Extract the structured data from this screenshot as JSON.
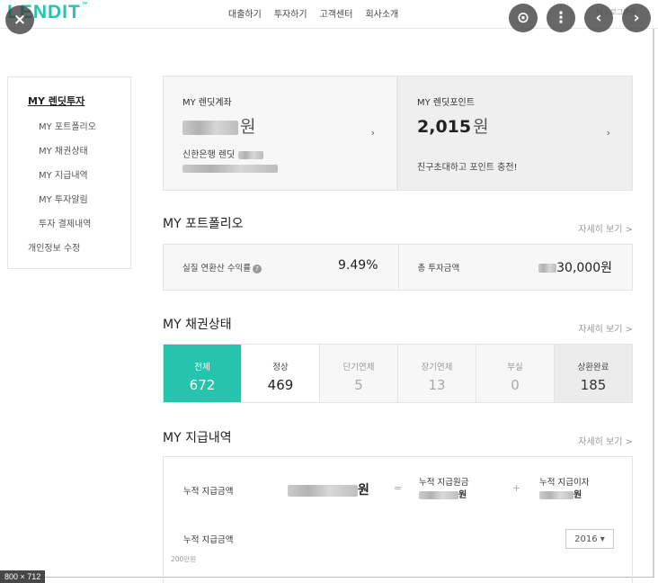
{
  "header": {
    "logo": "LENDIT",
    "logo_tm": "™",
    "nav": [
      "대출하기",
      "투자하기",
      "고객센터",
      "회사소개"
    ],
    "right_text": "님 | 로그아웃"
  },
  "viewer": {
    "size_badge": "800 × 712",
    "close_icon": "×",
    "lens_icon": "⊙",
    "more_icon": "⋮",
    "prev_icon": "‹",
    "next_icon": "›"
  },
  "sidebar": {
    "title": "MY 렌딧투자",
    "items": [
      "MY 포트폴리오",
      "MY 채권상태",
      "MY 지급내역",
      "MY 투자알림",
      "투자 결제내역"
    ],
    "extra": "개인정보 수정"
  },
  "account_card": {
    "label": "MY 렌딧계좌",
    "unit": "원",
    "bank": "신한은행 렌딧",
    "chevron": "›"
  },
  "point_card": {
    "label": "MY 렌딧포인트",
    "amount": "2,015",
    "unit": "원",
    "note": "친구초대하고 포인트 충전!",
    "chevron": "›"
  },
  "portfolio": {
    "title": "MY 포트폴리오",
    "more": "자세히 보기 >",
    "rate_label": "실질 연환산 수익률",
    "rate_value": "9.49%",
    "invest_label": "총 투자금액",
    "invest_value": "30,000원",
    "help_icon": "?"
  },
  "bonds": {
    "title": "MY 채권상태",
    "more": "자세히 보기 >",
    "items": [
      {
        "label": "전체",
        "value": "672"
      },
      {
        "label": "정상",
        "value": "469"
      },
      {
        "label": "단기연체",
        "value": "5"
      },
      {
        "label": "장기연체",
        "value": "13"
      },
      {
        "label": "부실",
        "value": "0"
      },
      {
        "label": "상환완료",
        "value": "185"
      }
    ]
  },
  "payouts": {
    "title": "MY 지급내역",
    "more": "자세히 보기 >",
    "total_label": "누적 지급금액",
    "total_unit": "원",
    "eq": "=",
    "plus": "+",
    "principal_label": "누적 지급원금",
    "principal_unit": "원",
    "interest_label": "누적 지급이자",
    "interest_unit": "원",
    "chart_label": "누적 지급금액",
    "year": "2016 ▾",
    "axis_top": "200만원"
  },
  "colors": {
    "accent": "#27c4ad"
  }
}
